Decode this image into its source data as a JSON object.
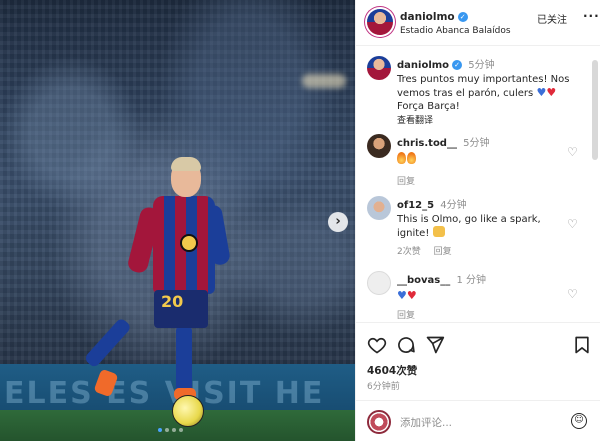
{
  "photo": {
    "banner_text": "ELES ES   VISIT HE",
    "shorts_number": "20",
    "next_arrow_glyph": "›",
    "slide_count": 4,
    "active_slide": 1
  },
  "header": {
    "username": "daniolmo",
    "location": "Estadio Abanca Balaídos",
    "follow_label": "已关注",
    "more_glyph": "···"
  },
  "caption": {
    "username": "daniolmo",
    "time": "5分钟",
    "text_line1": "Tres puntos muy importantes! Nos",
    "text_line2": "vemos tras el parón, culers",
    "text_line3": "Força Barça!",
    "see_translation": "查看翻译"
  },
  "comments": [
    {
      "username": "chris.tod__",
      "time": "5分钟",
      "text": "",
      "reply_label": "回复",
      "replies_label": ""
    },
    {
      "username": "of12_5",
      "time": "4分钟",
      "text_line1": "This is Olmo, go like a spark,",
      "text_line2": "ignite!",
      "replies_label": "2次赞",
      "reply_label": "回复"
    },
    {
      "username": "__bovas__",
      "time": "1 分钟",
      "text": "",
      "reply_label": "回复",
      "replies_label": ""
    }
  ],
  "actions": {
    "likes": "4604次赞",
    "time_ago": "6分钟前"
  },
  "compose": {
    "placeholder": "添加评论..."
  },
  "colors": {
    "accent_blue": "#3897f0",
    "heart_red": "#e02a3a",
    "text_dark": "#262626",
    "text_muted": "#8e8e8e"
  },
  "icons": {
    "like": "heart-outline-icon",
    "comment": "comment-bubble-icon",
    "share": "paper-plane-icon",
    "save": "bookmark-icon",
    "emoji": "smiley-icon",
    "verified": "verified-badge-icon"
  }
}
